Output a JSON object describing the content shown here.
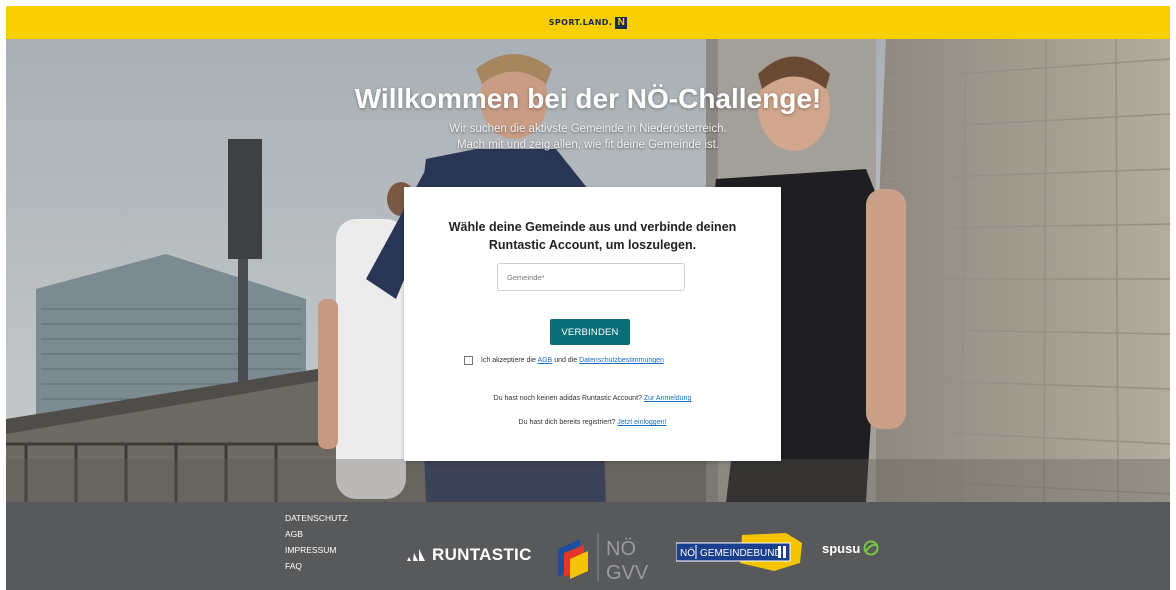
{
  "topbar": {
    "brand_text": "SPORT.LAND.",
    "brand_logo_letter": "N",
    "bg_color": "#f8cf00"
  },
  "hero": {
    "title": "Willkommen bei der NÖ-Challenge!",
    "subtitle_line1": "Wir suchen die aktivste Gemeinde in Niederösterreich.",
    "subtitle_line2": "Mach mit und zeig allen, wie fit deine Gemeinde ist."
  },
  "form": {
    "title": "Wähle deine Gemeinde aus und verbinde deinen Runtastic Account, um loszulegen.",
    "municipality_placeholder": "Gemeinde*",
    "connect_button": "VERBINDEN",
    "consent": {
      "prefix": "Ich akzeptiere die",
      "agb_link": "AGB",
      "middle": "und die",
      "privacy_link": "Datenschutzbestimmungen",
      "checked": false
    },
    "no_account_text": "Du hast noch keinen adidas Runtastic Account?",
    "register_link": "Zur Anmeldung",
    "registered_text": "Du hast dich bereits registriert?",
    "login_link": "Jetzt einloggen!",
    "button_color": "#0a6e78",
    "link_color": "#1a6fc4"
  },
  "footer": {
    "links": [
      "DATENSCHUTZ",
      "AGB",
      "IMPRESSUM",
      "FAQ"
    ],
    "bg_color": "#58595b",
    "logos": {
      "runtastic": "RUNTASTIC",
      "gvv_line1": "NÖ",
      "gvv_line2": "GVV",
      "gemeindebund_part1": "NÖ",
      "gemeindebund_part2": "GEMEINDEBUND",
      "spusu": "spusu"
    }
  }
}
